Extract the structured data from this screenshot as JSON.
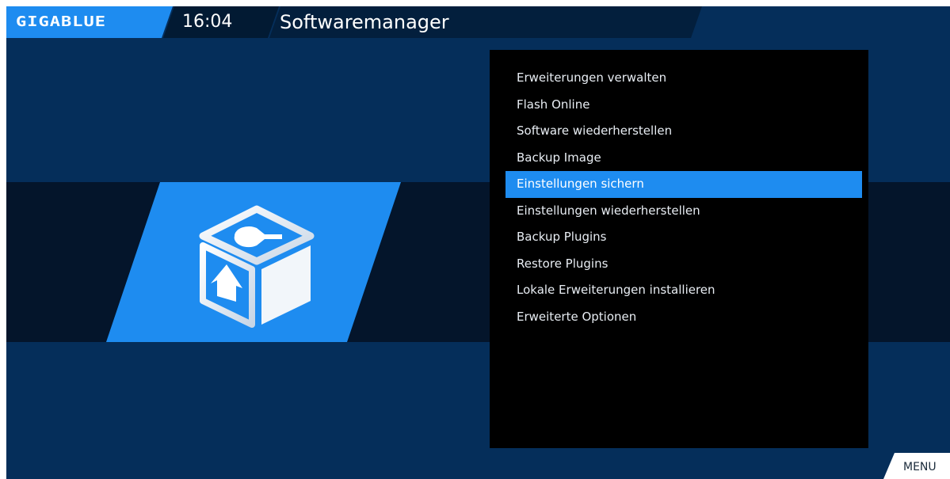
{
  "header": {
    "logo_text": "GIGABLUE",
    "time": "16:04",
    "title": "Softwaremanager"
  },
  "menu": {
    "items": [
      {
        "label": "Erweiterungen verwalten"
      },
      {
        "label": "Flash Online"
      },
      {
        "label": "Software wiederherstellen"
      },
      {
        "label": "Backup Image"
      },
      {
        "label": "Einstellungen sichern",
        "selected": true
      },
      {
        "label": "Einstellungen wiederherstellen"
      },
      {
        "label": "Backup Plugins"
      },
      {
        "label": "Restore Plugins"
      },
      {
        "label": "Lokale Erweiterungen installieren"
      },
      {
        "label": "Erweiterte Optionen"
      }
    ]
  },
  "footer": {
    "menu_key": "MENU"
  },
  "colors": {
    "accent": "#1e8cf0",
    "background": "#052e5a",
    "band": "#04152b",
    "panel": "#000000"
  },
  "icons": {
    "feature": "software-package-cube-icon"
  }
}
